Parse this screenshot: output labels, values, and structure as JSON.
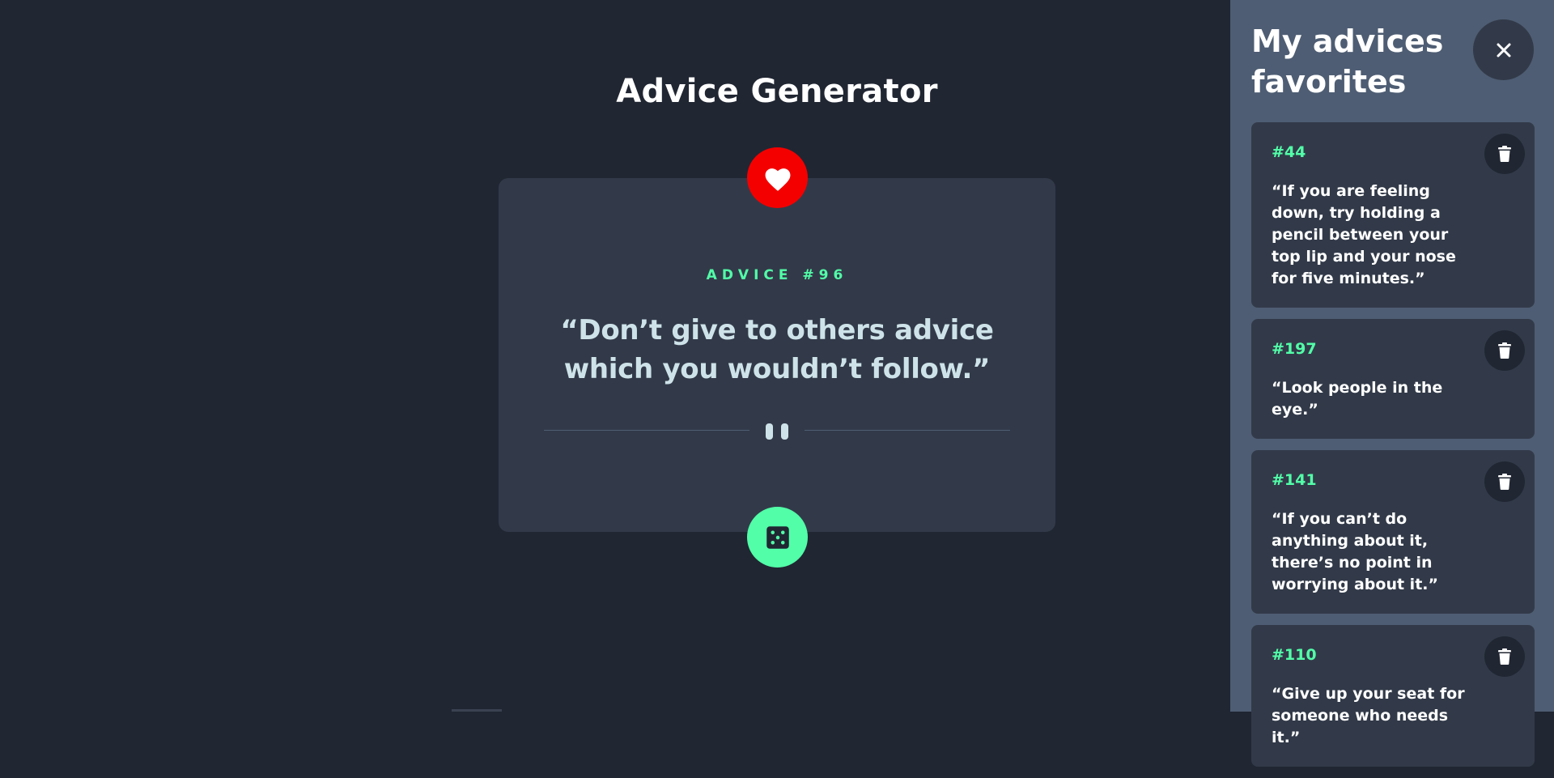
{
  "app": {
    "title": "Advice Generator"
  },
  "advice": {
    "id_label": "ADVICE #96",
    "text": "“Don’t give to others advice which you wouldn’t follow.”"
  },
  "icons": {
    "favorite": "heart-icon",
    "divider": "pause-icon",
    "generate": "dice-icon",
    "close": "close-icon",
    "delete": "trash-icon"
  },
  "colors": {
    "accent": "#52ffa8",
    "favorite_active": "#f40000",
    "background": "#202632",
    "card": "#323a49",
    "sidebar": "#4e5d73"
  },
  "sidebar": {
    "title": "My advices favorites",
    "favorites": [
      {
        "number": "#44",
        "text": "“If you are feeling down, try holding a pencil between your top lip and your nose for five minutes.”"
      },
      {
        "number": "#197",
        "text": "“Look people in the eye.”"
      },
      {
        "number": "#141",
        "text": "“If you can’t do anything about it, there’s no point in worrying about it.”"
      },
      {
        "number": "#110",
        "text": "“Give up your seat for someone who needs it.”"
      }
    ]
  }
}
